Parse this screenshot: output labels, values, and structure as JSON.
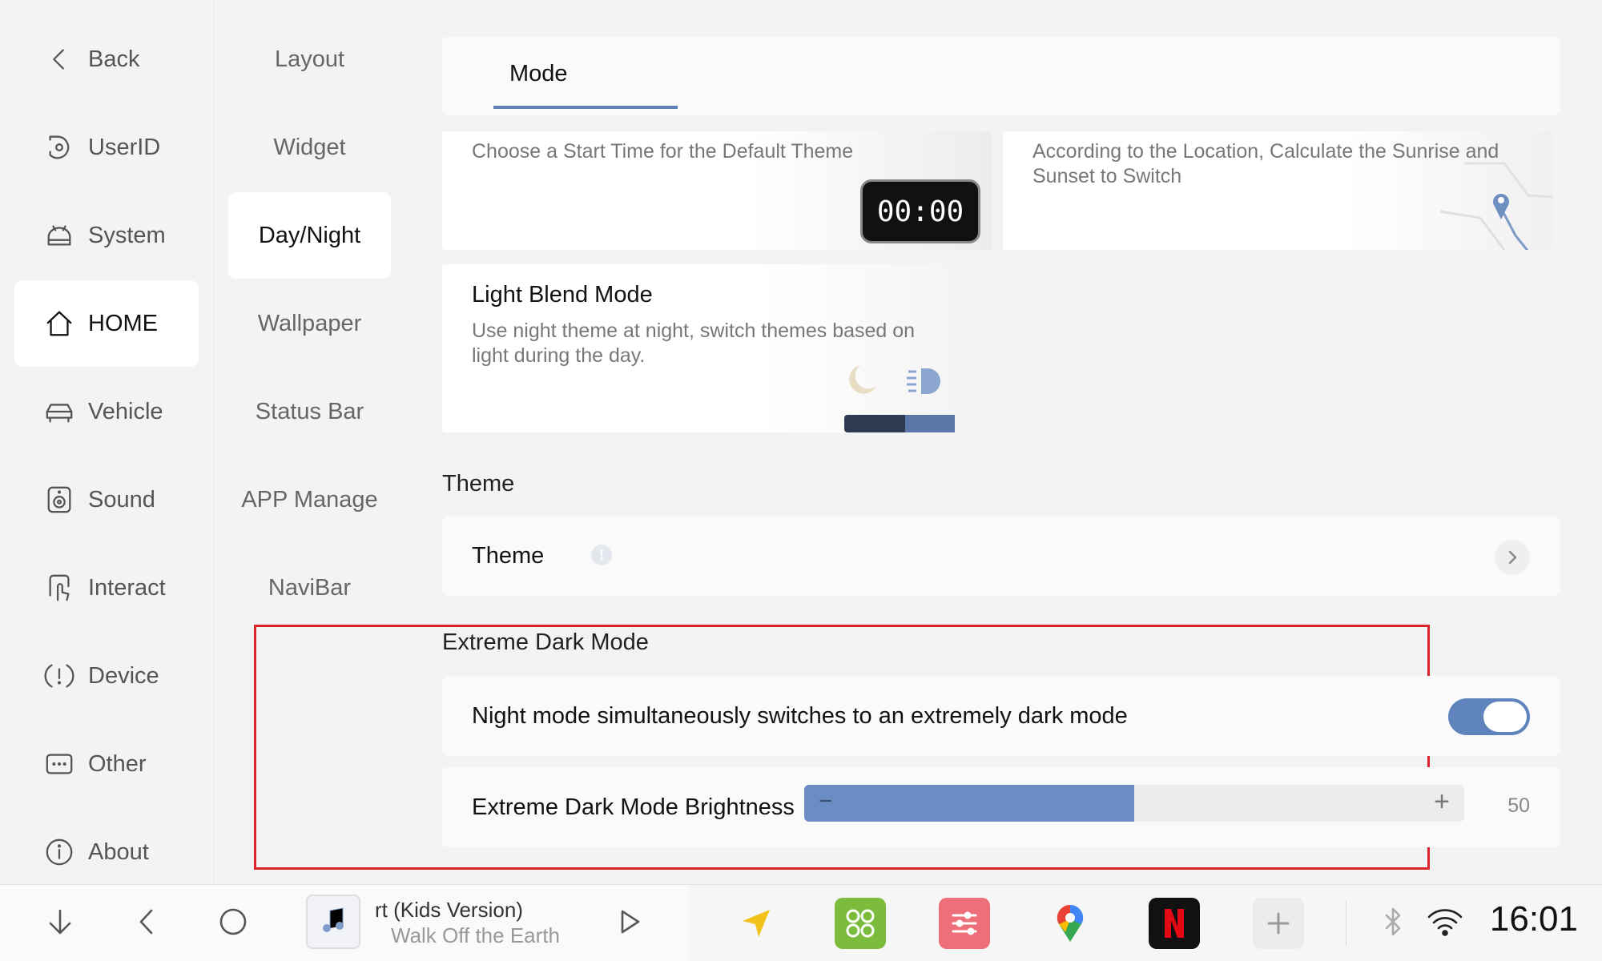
{
  "sidebar": {
    "items": [
      {
        "label": "Back",
        "icon": "back-icon"
      },
      {
        "label": "UserID",
        "icon": "userid-icon"
      },
      {
        "label": "System",
        "icon": "android-icon"
      },
      {
        "label": "HOME",
        "icon": "home-icon",
        "active": true
      },
      {
        "label": "Vehicle",
        "icon": "car-icon"
      },
      {
        "label": "Sound",
        "icon": "speaker-icon"
      },
      {
        "label": "Interact",
        "icon": "touch-icon"
      },
      {
        "label": "Device",
        "icon": "alert-icon"
      },
      {
        "label": "Other",
        "icon": "dots-icon"
      },
      {
        "label": "About",
        "icon": "info-icon"
      }
    ]
  },
  "subnav": {
    "items": [
      "Layout",
      "Widget",
      "Day/Night",
      "Wallpaper",
      "Status Bar",
      "APP Manage",
      "NaviBar"
    ],
    "active": "Day/Night"
  },
  "mode": {
    "tab_label": "Mode",
    "time_card": {
      "desc": "Choose a Start Time for the Default Theme",
      "clock": "00:00"
    },
    "location_card": {
      "desc": "According to the Location, Calculate the Sunrise and Sunset to Switch"
    },
    "blend_card": {
      "title": "Light Blend Mode",
      "desc": "Use night theme at night, switch themes based on light during the day."
    }
  },
  "theme": {
    "section_title": "Theme",
    "row_label": "Theme"
  },
  "extreme_dark": {
    "section_title": "Extreme Dark Mode",
    "toggle_label": "Night mode simultaneously switches to an extremely dark mode",
    "toggle_on": true,
    "brightness_label": "Extreme Dark Mode Brightness",
    "brightness_value": "50",
    "brightness_fraction": 0.5,
    "minus": "−",
    "plus": "+"
  },
  "bottombar": {
    "music_line1": "rt (Kids Version)",
    "music_line2": "Walk Off the Earth",
    "clock": "16:01",
    "apps": [
      "navigation-app",
      "widgets-app",
      "equalizer-app",
      "google-maps-app",
      "netflix-app",
      "add-app"
    ]
  },
  "colors": {
    "accent": "#5f84bd",
    "highlight": "#d9232d"
  }
}
